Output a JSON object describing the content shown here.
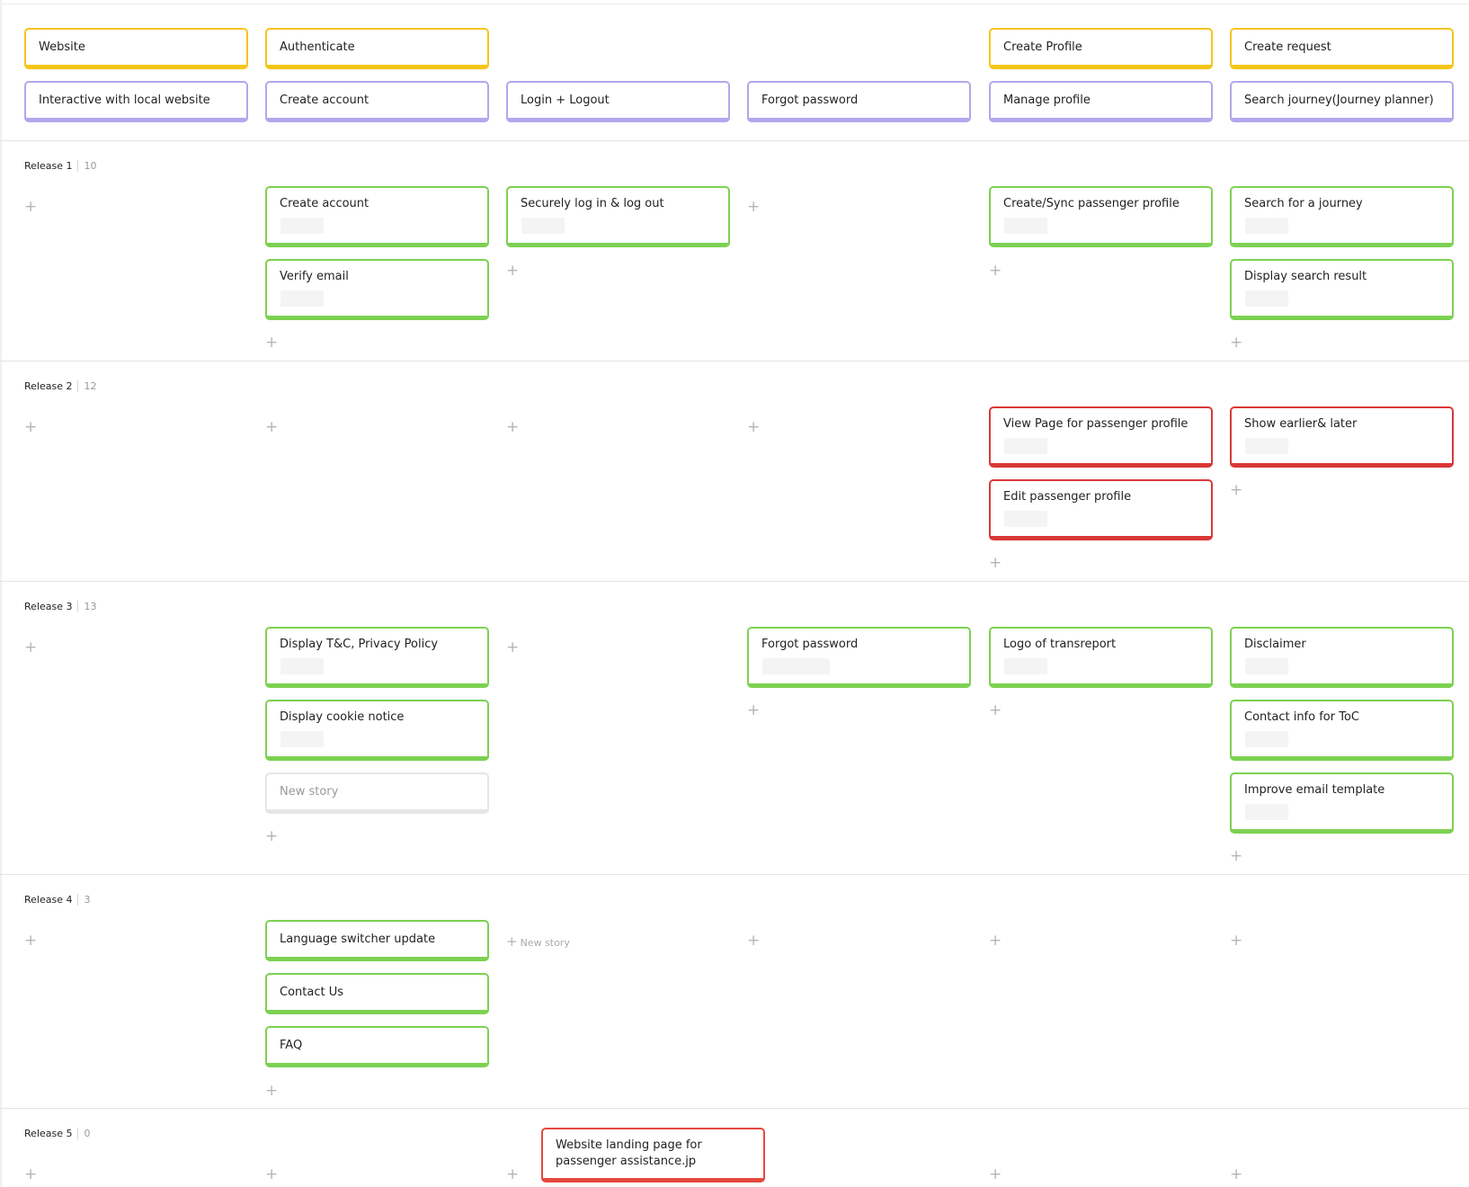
{
  "activities": [
    {
      "label": "Website"
    },
    {
      "label": "Authenticate"
    },
    {
      "label": "Create Profile"
    },
    {
      "label": "Create request"
    }
  ],
  "steps": [
    {
      "label": "Interactive with local website"
    },
    {
      "label": "Create account"
    },
    {
      "label": "Login + Logout"
    },
    {
      "label": "Forgot password"
    },
    {
      "label": "Manage profile"
    },
    {
      "label": "Search journey(Journey planner)"
    }
  ],
  "releases": [
    {
      "name": "Release 1",
      "count": "10",
      "stories": [
        "Create account",
        "Verify email",
        "Securely log in & log out",
        "Create/Sync passenger profile",
        "Search for a journey",
        "Display search result"
      ]
    },
    {
      "name": "Release 2",
      "count": "12",
      "stories": [
        "View Page for passenger profile",
        "Edit passenger profile",
        "Show earlier& later"
      ]
    },
    {
      "name": "Release 3",
      "count": "13",
      "stories": [
        "Display T&C, Privacy Policy",
        "Display cookie notice",
        "New story",
        "Forgot password",
        "Logo of transreport",
        "Disclaimer",
        "Contact info for ToC",
        "Improve email template"
      ]
    },
    {
      "name": "Release 4",
      "count": "3",
      "stories": [
        "Language switcher update",
        "Contact Us",
        "FAQ"
      ],
      "new_story_label": "New story"
    },
    {
      "name": "Release 5",
      "count": "0",
      "stories": [
        "Website landing page for passenger assistance.jp"
      ]
    }
  ],
  "icons": {
    "add": "plus-icon"
  },
  "colors": {
    "activity": "#f5c518",
    "step": "#b3a6ee",
    "story_green": "#7cd151",
    "story_red": "#d93838",
    "story_empty": "#e6e6e6"
  }
}
